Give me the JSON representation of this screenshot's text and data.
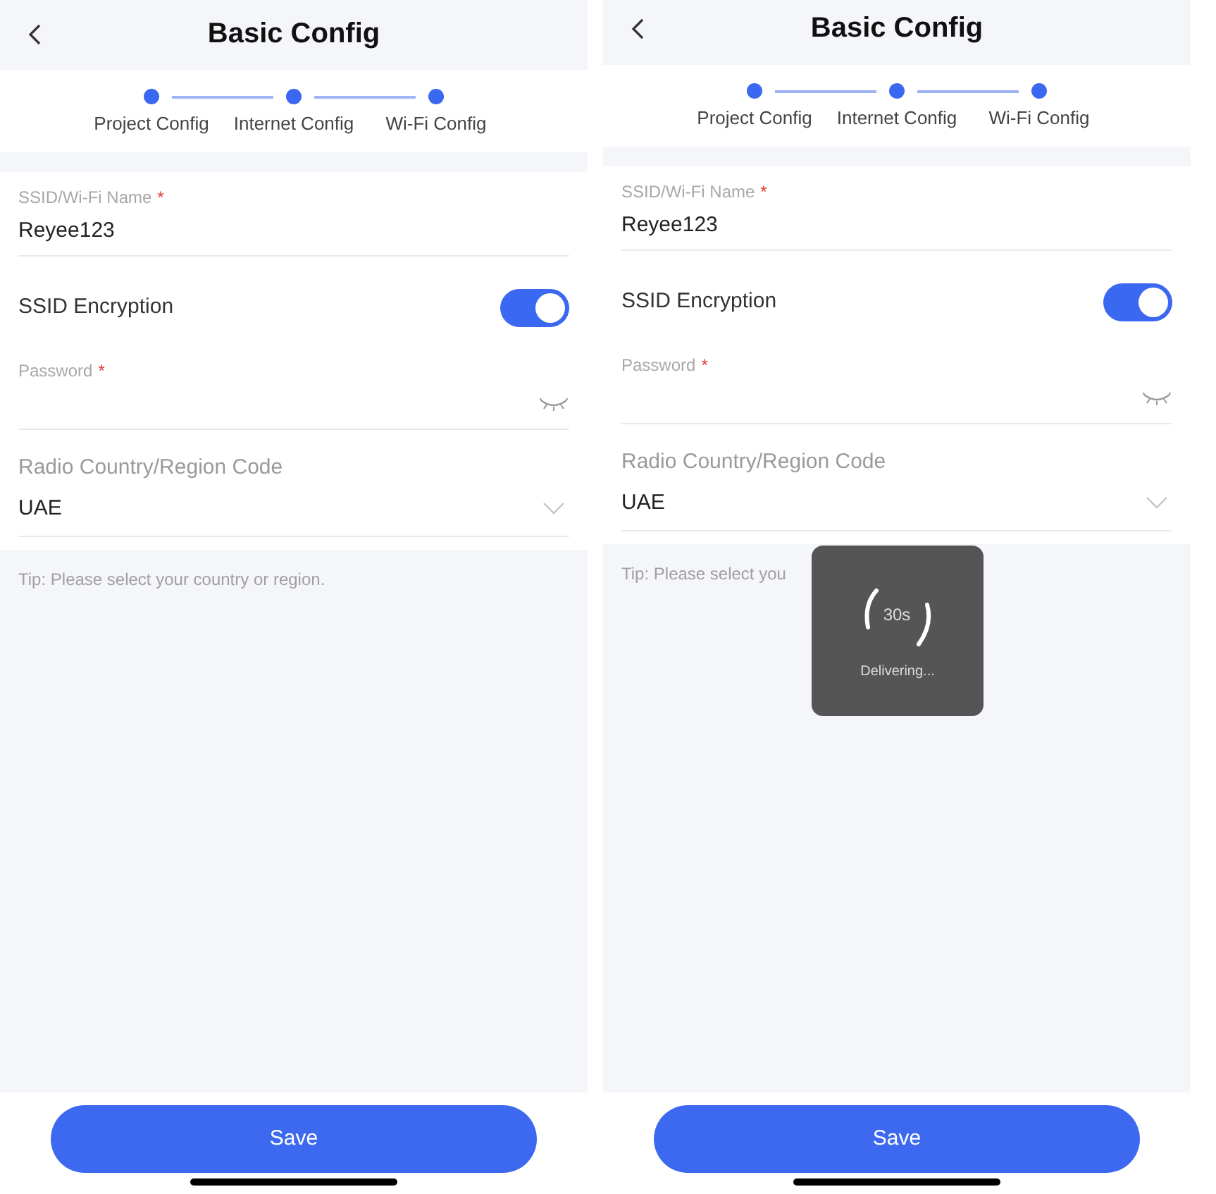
{
  "screens": [
    {
      "header": {
        "title": "Basic Config"
      },
      "steps": [
        {
          "label": "Project Config",
          "done": true
        },
        {
          "label": "Internet Config",
          "done": true
        },
        {
          "label": "Wi-Fi Config",
          "done": true
        }
      ],
      "form": [
        {
          "kind": "text",
          "label": "SSID/Wi-Fi Name",
          "required_mark": "*",
          "value": "Reyee123"
        },
        {
          "kind": "switch",
          "label": "SSID Encryption",
          "on": true
        },
        {
          "kind": "password",
          "label": "Password",
          "required_mark": "*",
          "visible": false
        },
        {
          "kind": "select",
          "label": "Radio Country/Region Code",
          "value": "UAE"
        }
      ],
      "tip": "Tip: Please select your country or region.",
      "save_button": "Save"
    },
    {
      "header": {
        "title": "Basic Config"
      },
      "steps": [
        {
          "label": "Project Config",
          "done": true
        },
        {
          "label": "Internet Config",
          "done": true
        },
        {
          "label": "Wi-Fi Config",
          "done": true
        }
      ],
      "form": [
        {
          "kind": "text",
          "label": "SSID/Wi-Fi Name",
          "required_mark": "*",
          "value": "Reyee123"
        },
        {
          "kind": "switch",
          "label": "SSID Encryption",
          "on": true
        },
        {
          "kind": "password",
          "label": "Password",
          "required_mark": "*",
          "visible": false
        },
        {
          "kind": "select",
          "label": "Radio Country/Region Code",
          "value": "UAE"
        }
      ],
      "tip": "Tip: Please select you",
      "toast": {
        "countdown": "30s",
        "message": "Delivering..."
      },
      "save_button": "Save"
    }
  ]
}
